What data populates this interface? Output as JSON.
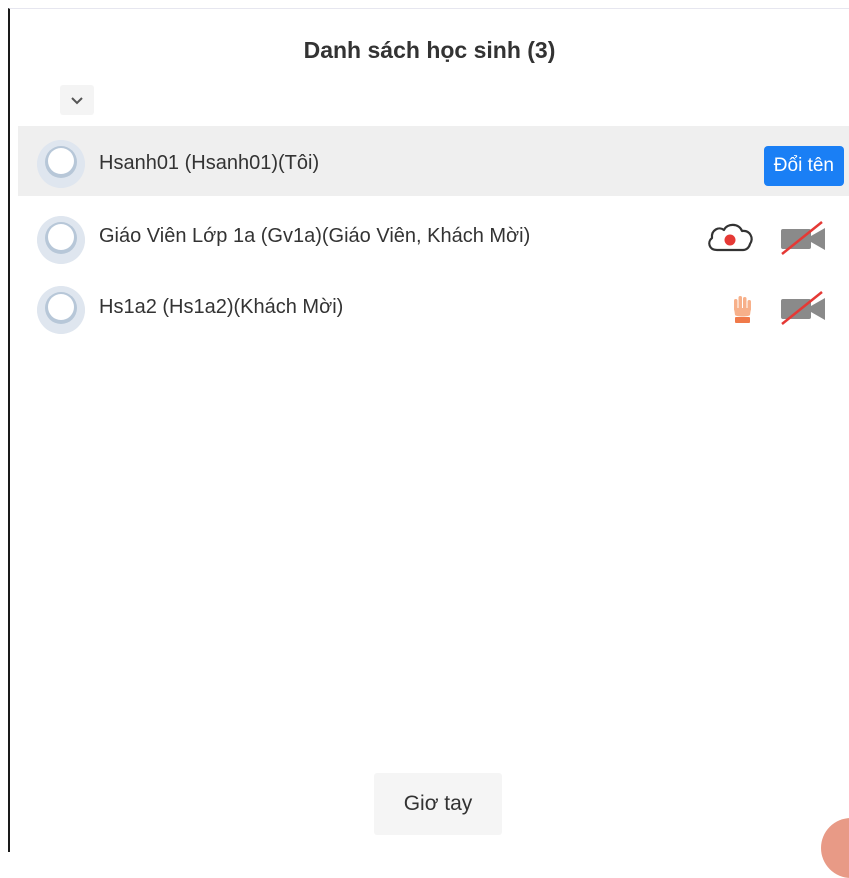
{
  "panel": {
    "title": "Danh sách học sinh (3)"
  },
  "participants": [
    {
      "label": "Hsanh01 (Hsanh01)(Tôi)",
      "action_label": "Đổi tên"
    },
    {
      "label": "Giáo Viên Lớp 1a (Gv1a)(Giáo Viên, Khách Mời)",
      "icons": [
        "cloud-record-icon",
        "camera-off-icon"
      ]
    },
    {
      "label": "Hs1a2 (Hs1a2)(Khách Mời)",
      "icons": [
        "raised-hand-icon",
        "camera-off-icon"
      ]
    }
  ],
  "footer": {
    "raise_hand_label": "Giơ tay"
  },
  "colors": {
    "accent": "#1a7ff5",
    "record_red": "#e53935",
    "hand_orange": "#f07a4a",
    "camera_gray": "#8a8a8a"
  }
}
